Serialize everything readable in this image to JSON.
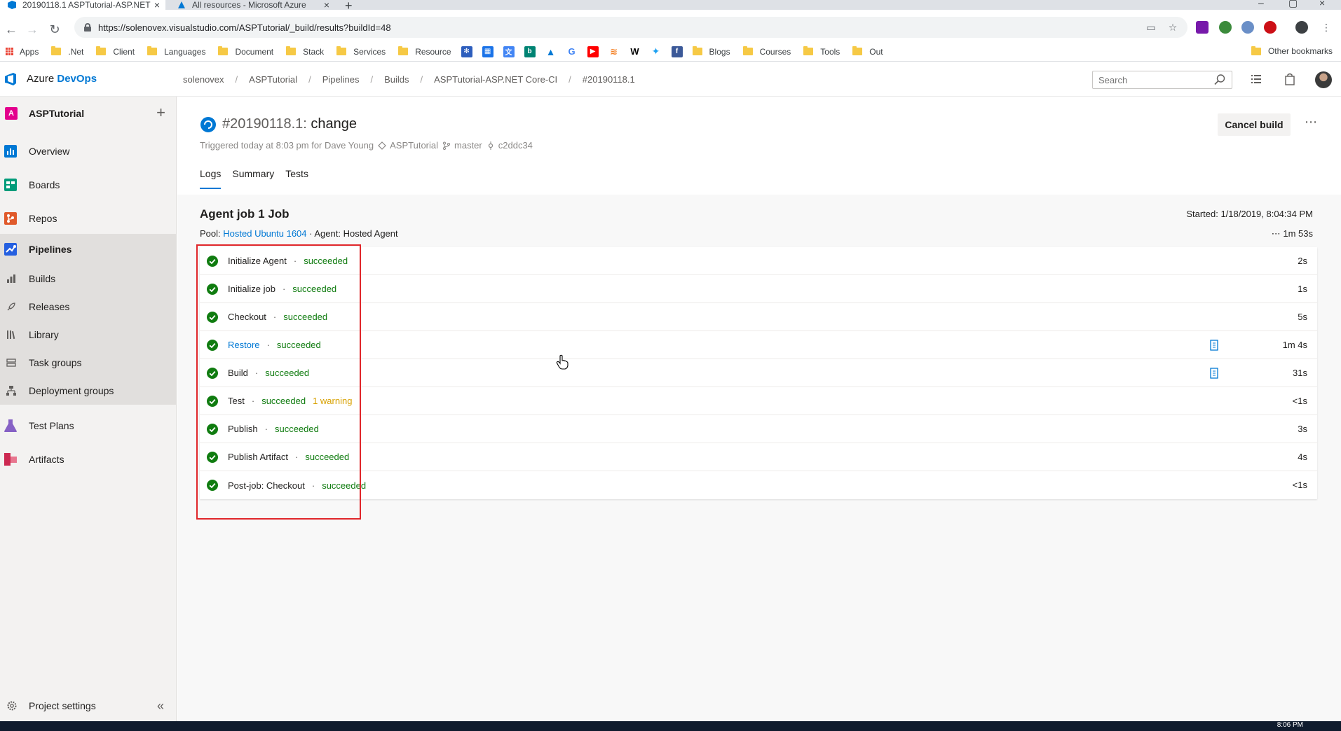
{
  "browser": {
    "tabs": [
      {
        "label": "20190118.1 ASPTutorial-ASP.NET",
        "active": true
      },
      {
        "label": "All resources - Microsoft Azure",
        "active": false
      }
    ],
    "url": "https://solenovex.visualstudio.com/ASPTutorial/_build/results?buildId=48",
    "bookmarks": [
      {
        "label": "Apps",
        "icon": "apps-grid-icon"
      },
      {
        "label": ".Net",
        "icon": "folder-icon"
      },
      {
        "label": "Client",
        "icon": "folder-icon"
      },
      {
        "label": "Languages",
        "icon": "folder-icon"
      },
      {
        "label": "Document",
        "icon": "folder-icon"
      },
      {
        "label": "Stack",
        "icon": "folder-icon"
      },
      {
        "label": "Services",
        "icon": "folder-icon"
      },
      {
        "label": "Resource",
        "icon": "folder-icon"
      }
    ],
    "bookmarks_after_icons": [
      {
        "label": "Blogs"
      },
      {
        "label": "Courses"
      },
      {
        "label": "Tools"
      },
      {
        "label": "Out"
      }
    ],
    "other_bookmarks": "Other bookmarks"
  },
  "header": {
    "brand_prefix": "Azure",
    "brand_suffix": "DevOps",
    "breadcrumbs": [
      "solenovex",
      "ASPTutorial",
      "Pipelines",
      "Builds",
      "ASPTutorial-ASP.NET Core-CI",
      "#20190118.1"
    ],
    "search_placeholder": "Search"
  },
  "sidebar": {
    "project_badge": "A",
    "project_name": "ASPTutorial",
    "items": [
      {
        "label": "Overview",
        "color": "#0078d4"
      },
      {
        "label": "Boards",
        "color": "#009c7a"
      },
      {
        "label": "Repos",
        "color": "#e05a2b"
      },
      {
        "label": "Pipelines",
        "color": "#2560e0"
      }
    ],
    "pipeline_subitems": [
      {
        "label": "Builds"
      },
      {
        "label": "Releases"
      },
      {
        "label": "Library"
      },
      {
        "label": "Task groups"
      },
      {
        "label": "Deployment groups"
      }
    ],
    "items_after": [
      {
        "label": "Test Plans",
        "color": "#8661c5"
      },
      {
        "label": "Artifacts",
        "color": "#cc2951"
      }
    ],
    "project_settings": "Project settings"
  },
  "build": {
    "number": "#20190118.1:",
    "title": "change",
    "triggered": "Triggered today at 8:03 pm for Dave Young",
    "repo": "ASPTutorial",
    "branch": "master",
    "commit": "c2ddc34",
    "cancel_label": "Cancel build",
    "more_label": "⋯",
    "tabs": [
      "Logs",
      "Summary",
      "Tests"
    ],
    "active_tab": "Logs"
  },
  "job": {
    "title": "Agent job 1 Job",
    "pool_label": "Pool:",
    "pool_name": "Hosted Ubuntu 1604",
    "agent": "· Agent: Hosted Agent",
    "started": "Started: 1/18/2019, 8:04:34 PM",
    "duration": "⋯  1m 53s",
    "status_color": "#107c10",
    "steps": [
      {
        "name": "Initialize Agent",
        "status": "succeeded",
        "warning": "",
        "time": "2s",
        "has_log": false,
        "link": false
      },
      {
        "name": "Initialize job",
        "status": "succeeded",
        "warning": "",
        "time": "1s",
        "has_log": false,
        "link": false
      },
      {
        "name": "Checkout",
        "status": "succeeded",
        "warning": "",
        "time": "5s",
        "has_log": false,
        "link": false
      },
      {
        "name": "Restore",
        "status": "succeeded",
        "warning": "",
        "time": "1m 4s",
        "has_log": true,
        "link": true
      },
      {
        "name": "Build",
        "status": "succeeded",
        "warning": "",
        "time": "31s",
        "has_log": true,
        "link": false
      },
      {
        "name": "Test",
        "status": "succeeded",
        "warning": "1 warning",
        "time": "<1s",
        "has_log": false,
        "link": false
      },
      {
        "name": "Publish",
        "status": "succeeded",
        "warning": "",
        "time": "3s",
        "has_log": false,
        "link": false
      },
      {
        "name": "Publish Artifact",
        "status": "succeeded",
        "warning": "",
        "time": "4s",
        "has_log": false,
        "link": false
      },
      {
        "name": "Post-job: Checkout",
        "status": "succeeded",
        "warning": "",
        "time": "<1s",
        "has_log": false,
        "link": false
      }
    ]
  },
  "taskbar": {
    "clock": "8:06 PM"
  }
}
